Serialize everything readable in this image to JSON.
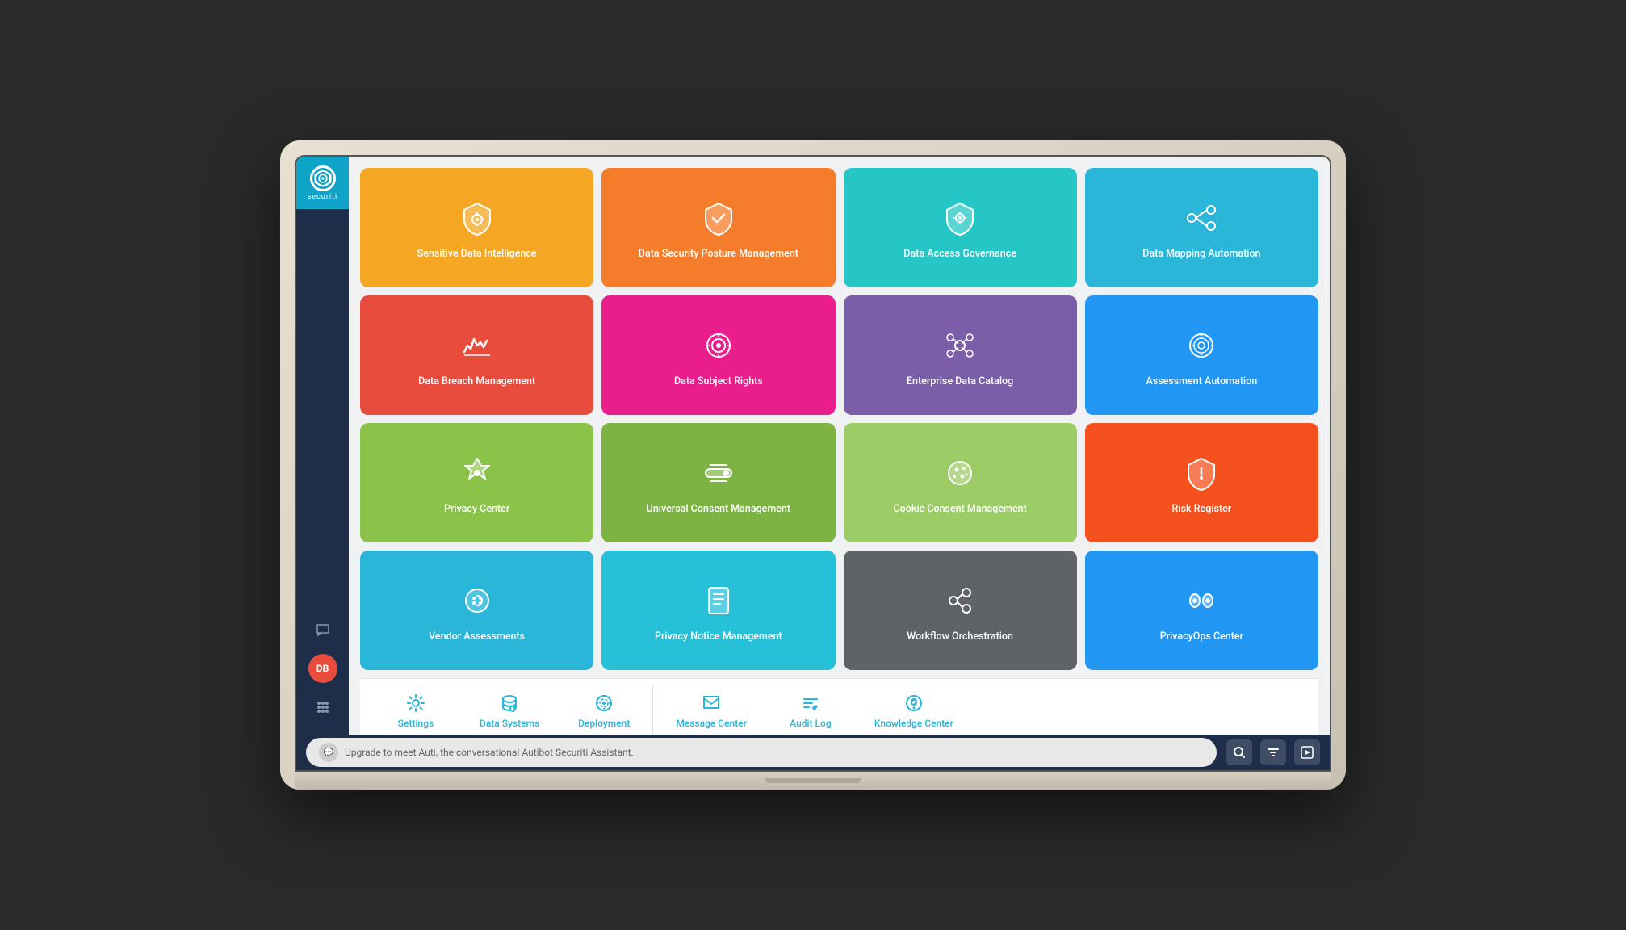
{
  "app": {
    "name": "securiti",
    "tagline": "Upgrade to meet Auti, the conversational Autibot Securiti Assistant."
  },
  "sidebar": {
    "logo_text": "securiti",
    "items": [
      {
        "id": "chat",
        "icon": "💬"
      },
      {
        "id": "avatar",
        "label": "DB"
      },
      {
        "id": "grid",
        "icon": "⠿"
      }
    ]
  },
  "tiles": [
    [
      {
        "id": "sensitive-data",
        "label": "Sensitive Data Intelligence",
        "color": "orange",
        "icon": "shield-gear"
      },
      {
        "id": "dspm",
        "label": "Data Security Posture Management",
        "color": "orange2",
        "icon": "shield-check"
      },
      {
        "id": "dag",
        "label": "Data Access Governance",
        "color": "teal",
        "icon": "shield-key"
      },
      {
        "id": "dma",
        "label": "Data Mapping Automation",
        "color": "blue-light",
        "icon": "share"
      }
    ],
    [
      {
        "id": "dbm",
        "label": "Data Breach Management",
        "color": "red",
        "icon": "wifi-alert"
      },
      {
        "id": "dsr",
        "label": "Data Subject Rights",
        "color": "pink",
        "icon": "gear-circle"
      },
      {
        "id": "edc",
        "label": "Enterprise Data Catalog",
        "color": "purple",
        "icon": "nodes"
      },
      {
        "id": "aa",
        "label": "Assessment Automation",
        "color": "blue",
        "icon": "target"
      }
    ],
    [
      {
        "id": "pc",
        "label": "Privacy Center",
        "color": "green",
        "icon": "hexagon-gear"
      },
      {
        "id": "ucm",
        "label": "Universal Consent Management",
        "color": "green2",
        "icon": "toggle"
      },
      {
        "id": "ccm",
        "label": "Cookie Consent Management",
        "color": "green3",
        "icon": "cookie"
      },
      {
        "id": "rr",
        "label": "Risk Register",
        "color": "orange-red",
        "icon": "shield-exclaim"
      }
    ],
    [
      {
        "id": "va",
        "label": "Vendor Assessments",
        "color": "sky",
        "icon": "gear-dots"
      },
      {
        "id": "pnm",
        "label": "Privacy Notice Management",
        "color": "sky2",
        "icon": "doc-lines"
      },
      {
        "id": "wo",
        "label": "Workflow Orchestration",
        "color": "gray",
        "icon": "fork"
      },
      {
        "id": "poc",
        "label": "PrivacyOps Center",
        "color": "sky3",
        "icon": "eyes"
      }
    ]
  ],
  "utility": [
    {
      "id": "settings",
      "label": "Settings",
      "icon": "gear"
    },
    {
      "id": "data-systems",
      "label": "Data Systems",
      "icon": "db"
    },
    {
      "id": "deployment",
      "label": "Deployment",
      "icon": "deploy"
    },
    {
      "id": "message-center",
      "label": "Message Center",
      "icon": "msg"
    },
    {
      "id": "audit-log",
      "label": "Audit Log",
      "icon": "audit"
    },
    {
      "id": "knowledge-center",
      "label": "Knowledge Center",
      "icon": "help"
    }
  ]
}
